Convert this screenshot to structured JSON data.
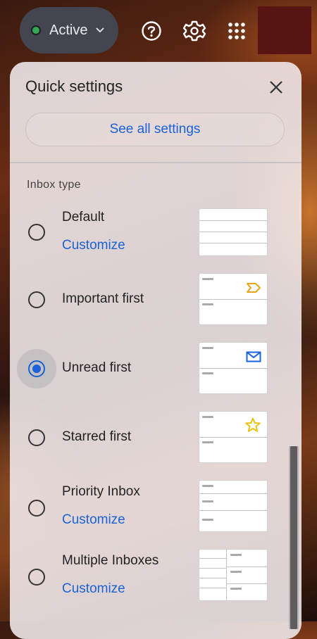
{
  "topbar": {
    "status_label": "Active",
    "status_color": "#34a853",
    "icons": [
      "help-icon",
      "gear-icon",
      "apps-grid-icon"
    ]
  },
  "panel": {
    "title": "Quick settings",
    "see_all_label": "See all settings",
    "section_label": "Inbox type",
    "options": [
      {
        "label": "Default",
        "link": "Customize",
        "selected": false
      },
      {
        "label": "Important first",
        "selected": false
      },
      {
        "label": "Unread first",
        "selected": true
      },
      {
        "label": "Starred first",
        "selected": false
      },
      {
        "label": "Priority Inbox",
        "link": "Customize",
        "selected": false
      },
      {
        "label": "Multiple Inboxes",
        "link": "Customize",
        "selected": false
      }
    ]
  },
  "colors": {
    "accent": "#1a62d8",
    "important_marker": "#e8a317",
    "star": "#e8c417"
  }
}
